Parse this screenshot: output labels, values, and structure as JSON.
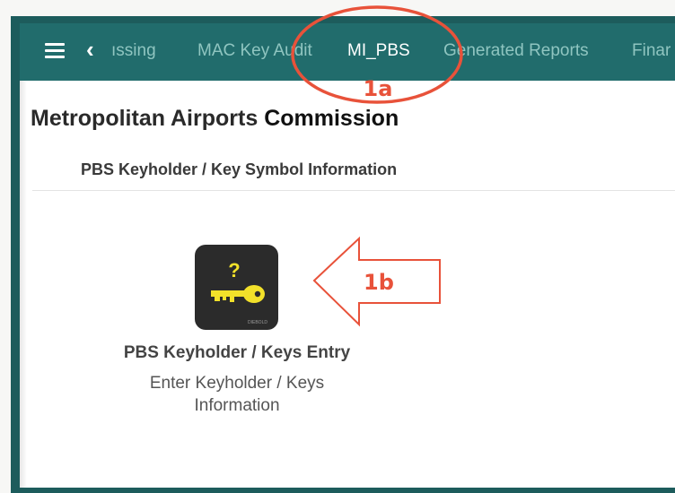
{
  "nav": {
    "back_icon": "chevron-left-icon",
    "tabs": [
      {
        "label": "ıssing",
        "active": false
      },
      {
        "label": "MAC Key Audit",
        "active": false
      },
      {
        "label": "MI_PBS",
        "active": true
      },
      {
        "label": "Generated Reports",
        "active": false
      },
      {
        "label": "Finar",
        "active": false
      }
    ]
  },
  "page": {
    "title_part1": "Metropolitan Airports ",
    "title_part2": "Commission",
    "section_title": "PBS Keyholder / Key Symbol Information"
  },
  "tile": {
    "icon": "key-question-icon",
    "icon_caption": "DIEBOLD",
    "title": "PBS Keyholder / Keys Entry",
    "subtitle_line1": "Enter Keyholder / Keys",
    "subtitle_line2": "Information"
  },
  "annotations": {
    "callout_a": "1a",
    "callout_b": "1b",
    "color": "#e8523a"
  },
  "colors": {
    "navbar": "#216c6c",
    "nav_tab_inactive": "#8fc5c0",
    "nav_tab_active": "#ffffff",
    "icon_bg": "#2b2b2b",
    "key": "#f2e12a"
  }
}
